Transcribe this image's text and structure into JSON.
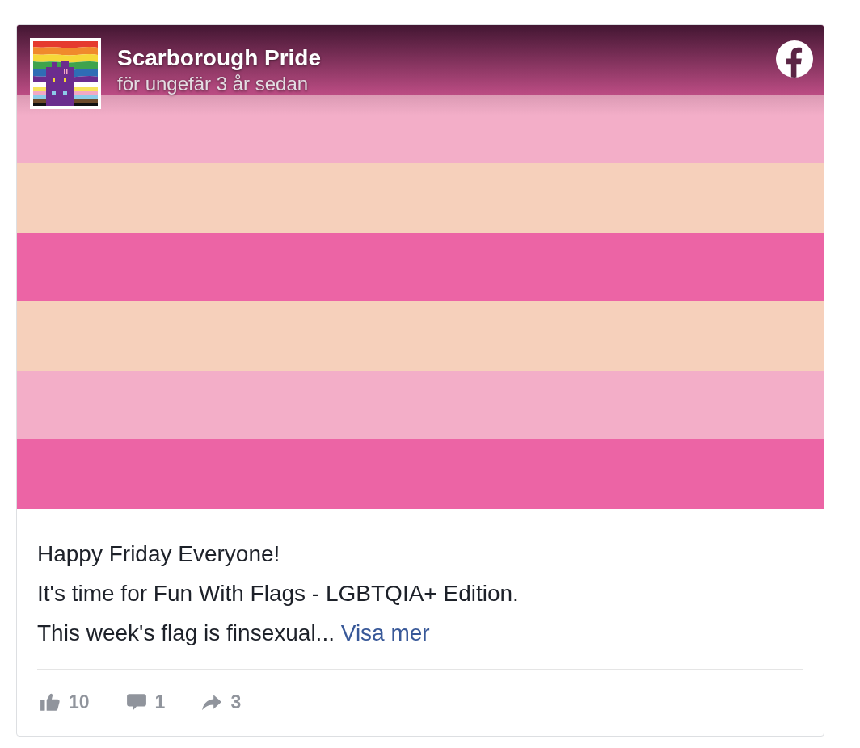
{
  "post": {
    "page_name": "Scarborough Pride",
    "timestamp": "för ungefär 3 år sedan",
    "paragraphs": [
      "Happy Friday Everyone!",
      "It's time for Fun With Flags - LGBTQIA+ Edition.",
      "This week's flag is finsexual..."
    ],
    "see_more": "Visa mer"
  },
  "stats": [
    {
      "kind": "likes",
      "count": "10"
    },
    {
      "kind": "comments",
      "count": "1"
    },
    {
      "kind": "shares",
      "count": "3"
    }
  ]
}
